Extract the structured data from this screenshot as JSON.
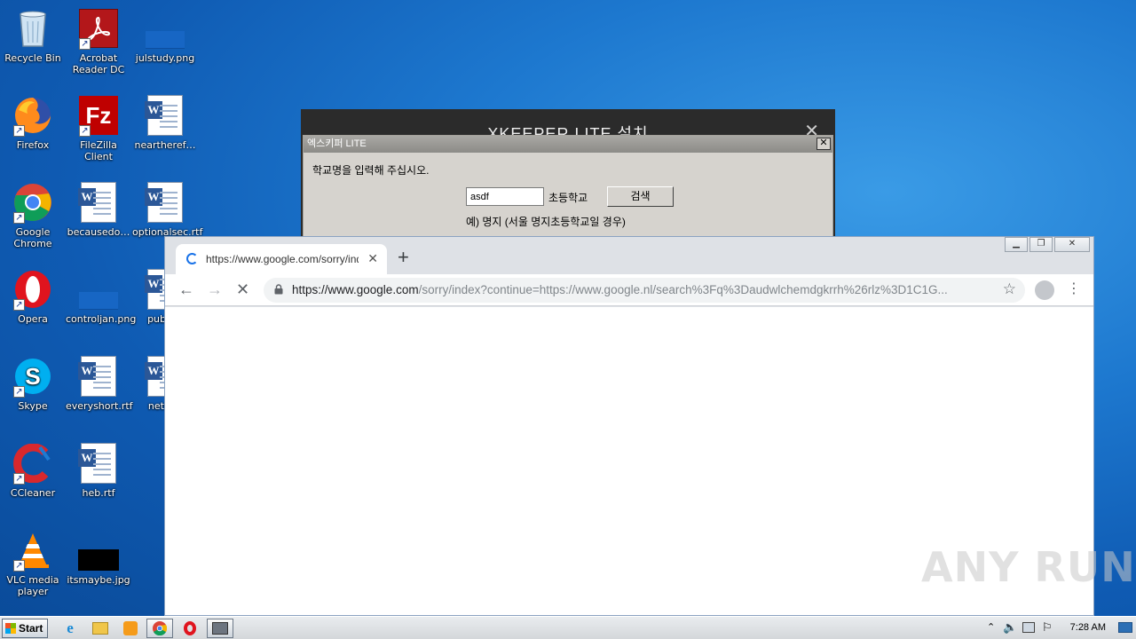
{
  "desktop": {
    "icons": [
      {
        "label": "Recycle Bin",
        "icon": "recycle-bin-icon"
      },
      {
        "label": "Acrobat Reader DC",
        "icon": "acrobat-icon"
      },
      {
        "label": "julstudy.png",
        "icon": "image-file-icon"
      },
      {
        "label": "Firefox",
        "icon": "firefox-icon"
      },
      {
        "label": "FileZilla Client",
        "icon": "filezilla-icon"
      },
      {
        "label": "neartheref…",
        "icon": "word-doc-icon"
      },
      {
        "label": "Google Chrome",
        "icon": "chrome-icon"
      },
      {
        "label": "becausedo…",
        "icon": "word-doc-icon"
      },
      {
        "label": "optionalsec.rtf",
        "icon": "word-doc-icon"
      },
      {
        "label": "Opera",
        "icon": "opera-icon"
      },
      {
        "label": "controljan.png",
        "icon": "image-file-icon"
      },
      {
        "label": "publica",
        "icon": "word-doc-icon"
      },
      {
        "label": "Skype",
        "icon": "skype-icon"
      },
      {
        "label": "everyshort.rtf",
        "icon": "word-doc-icon"
      },
      {
        "label": "networ",
        "icon": "word-doc-icon"
      },
      {
        "label": "CCleaner",
        "icon": "ccleaner-icon"
      },
      {
        "label": "heb.rtf",
        "icon": "word-doc-icon"
      },
      {
        "label": "VLC media player",
        "icon": "vlc-icon"
      },
      {
        "label": "itsmaybe.jpg",
        "icon": "image-file-icon"
      }
    ]
  },
  "xkeeper": {
    "back_title": "XKEEPER LITE 설치",
    "dialog_title": "엑스키퍼 LITE",
    "prompt": "학교명을 입력해 주십시오.",
    "school_input_value": "asdf",
    "suffix": "초등학교",
    "search_button": "검색",
    "example": "예) 명지 (서울 명지초등학교일 경우)"
  },
  "chrome": {
    "tab_title": "https://www.google.com/sorry/inde",
    "url_host": "https://www.google.com",
    "url_path": "/sorry/index?continue=https://www.google.nl/search%3Fq%3Daudwlchemdgkrrh%26rlz%3D1C1G..."
  },
  "watermark": "ANY RUN",
  "taskbar": {
    "start_label": "Start",
    "clock": "7:28 AM",
    "pinned": [
      "ie-icon",
      "explorer-icon",
      "media-player-icon",
      "chrome-icon",
      "opera-icon",
      "installer-icon"
    ]
  },
  "colors": {
    "desktop_blue": "#1d78cf",
    "chrome_frame": "#dee1e6",
    "xkeeper_dark": "#2b2b2b"
  }
}
